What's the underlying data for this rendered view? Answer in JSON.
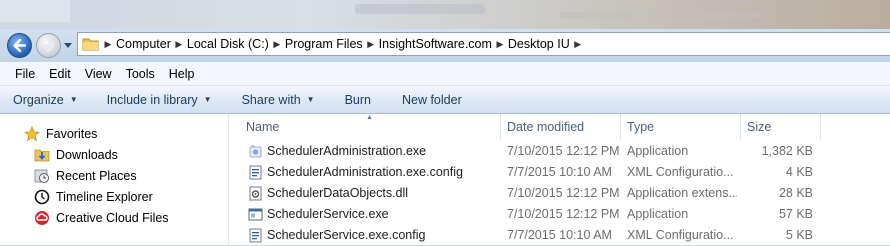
{
  "address": {
    "crumbs": [
      "Computer",
      "Local Disk (C:)",
      "Program Files",
      "InsightSoftware.com",
      "Desktop IU"
    ]
  },
  "menu": [
    "File",
    "Edit",
    "View",
    "Tools",
    "Help"
  ],
  "toolbar": {
    "organize": "Organize",
    "include_in_library": "Include in library",
    "share_with": "Share with",
    "burn": "Burn",
    "new_folder": "New folder"
  },
  "nav": {
    "favorites": "Favorites",
    "items": [
      "Downloads",
      "Recent Places",
      "Timeline Explorer",
      "Creative Cloud Files"
    ]
  },
  "columns": {
    "name": "Name",
    "date": "Date modified",
    "type": "Type",
    "size": "Size"
  },
  "files": [
    {
      "name": "SchedulerAdministration.exe",
      "date": "7/10/2015 12:12 PM",
      "type": "Application",
      "size": "1,382 KB",
      "icon": "application-icon"
    },
    {
      "name": "SchedulerAdministration.exe.config",
      "date": "7/7/2015 10:10 AM",
      "type": "XML Configuratio...",
      "size": "4 KB",
      "icon": "config-file-icon"
    },
    {
      "name": "SchedulerDataObjects.dll",
      "date": "7/10/2015 12:12 PM",
      "type": "Application extens...",
      "size": "28 KB",
      "icon": "dll-file-icon"
    },
    {
      "name": "SchedulerService.exe",
      "date": "7/10/2015 12:12 PM",
      "type": "Application",
      "size": "57 KB",
      "icon": "window-app-icon"
    },
    {
      "name": "SchedulerService.exe.config",
      "date": "7/7/2015 10:10 AM",
      "type": "XML Configuratio...",
      "size": "5 KB",
      "icon": "config-file-icon"
    }
  ]
}
